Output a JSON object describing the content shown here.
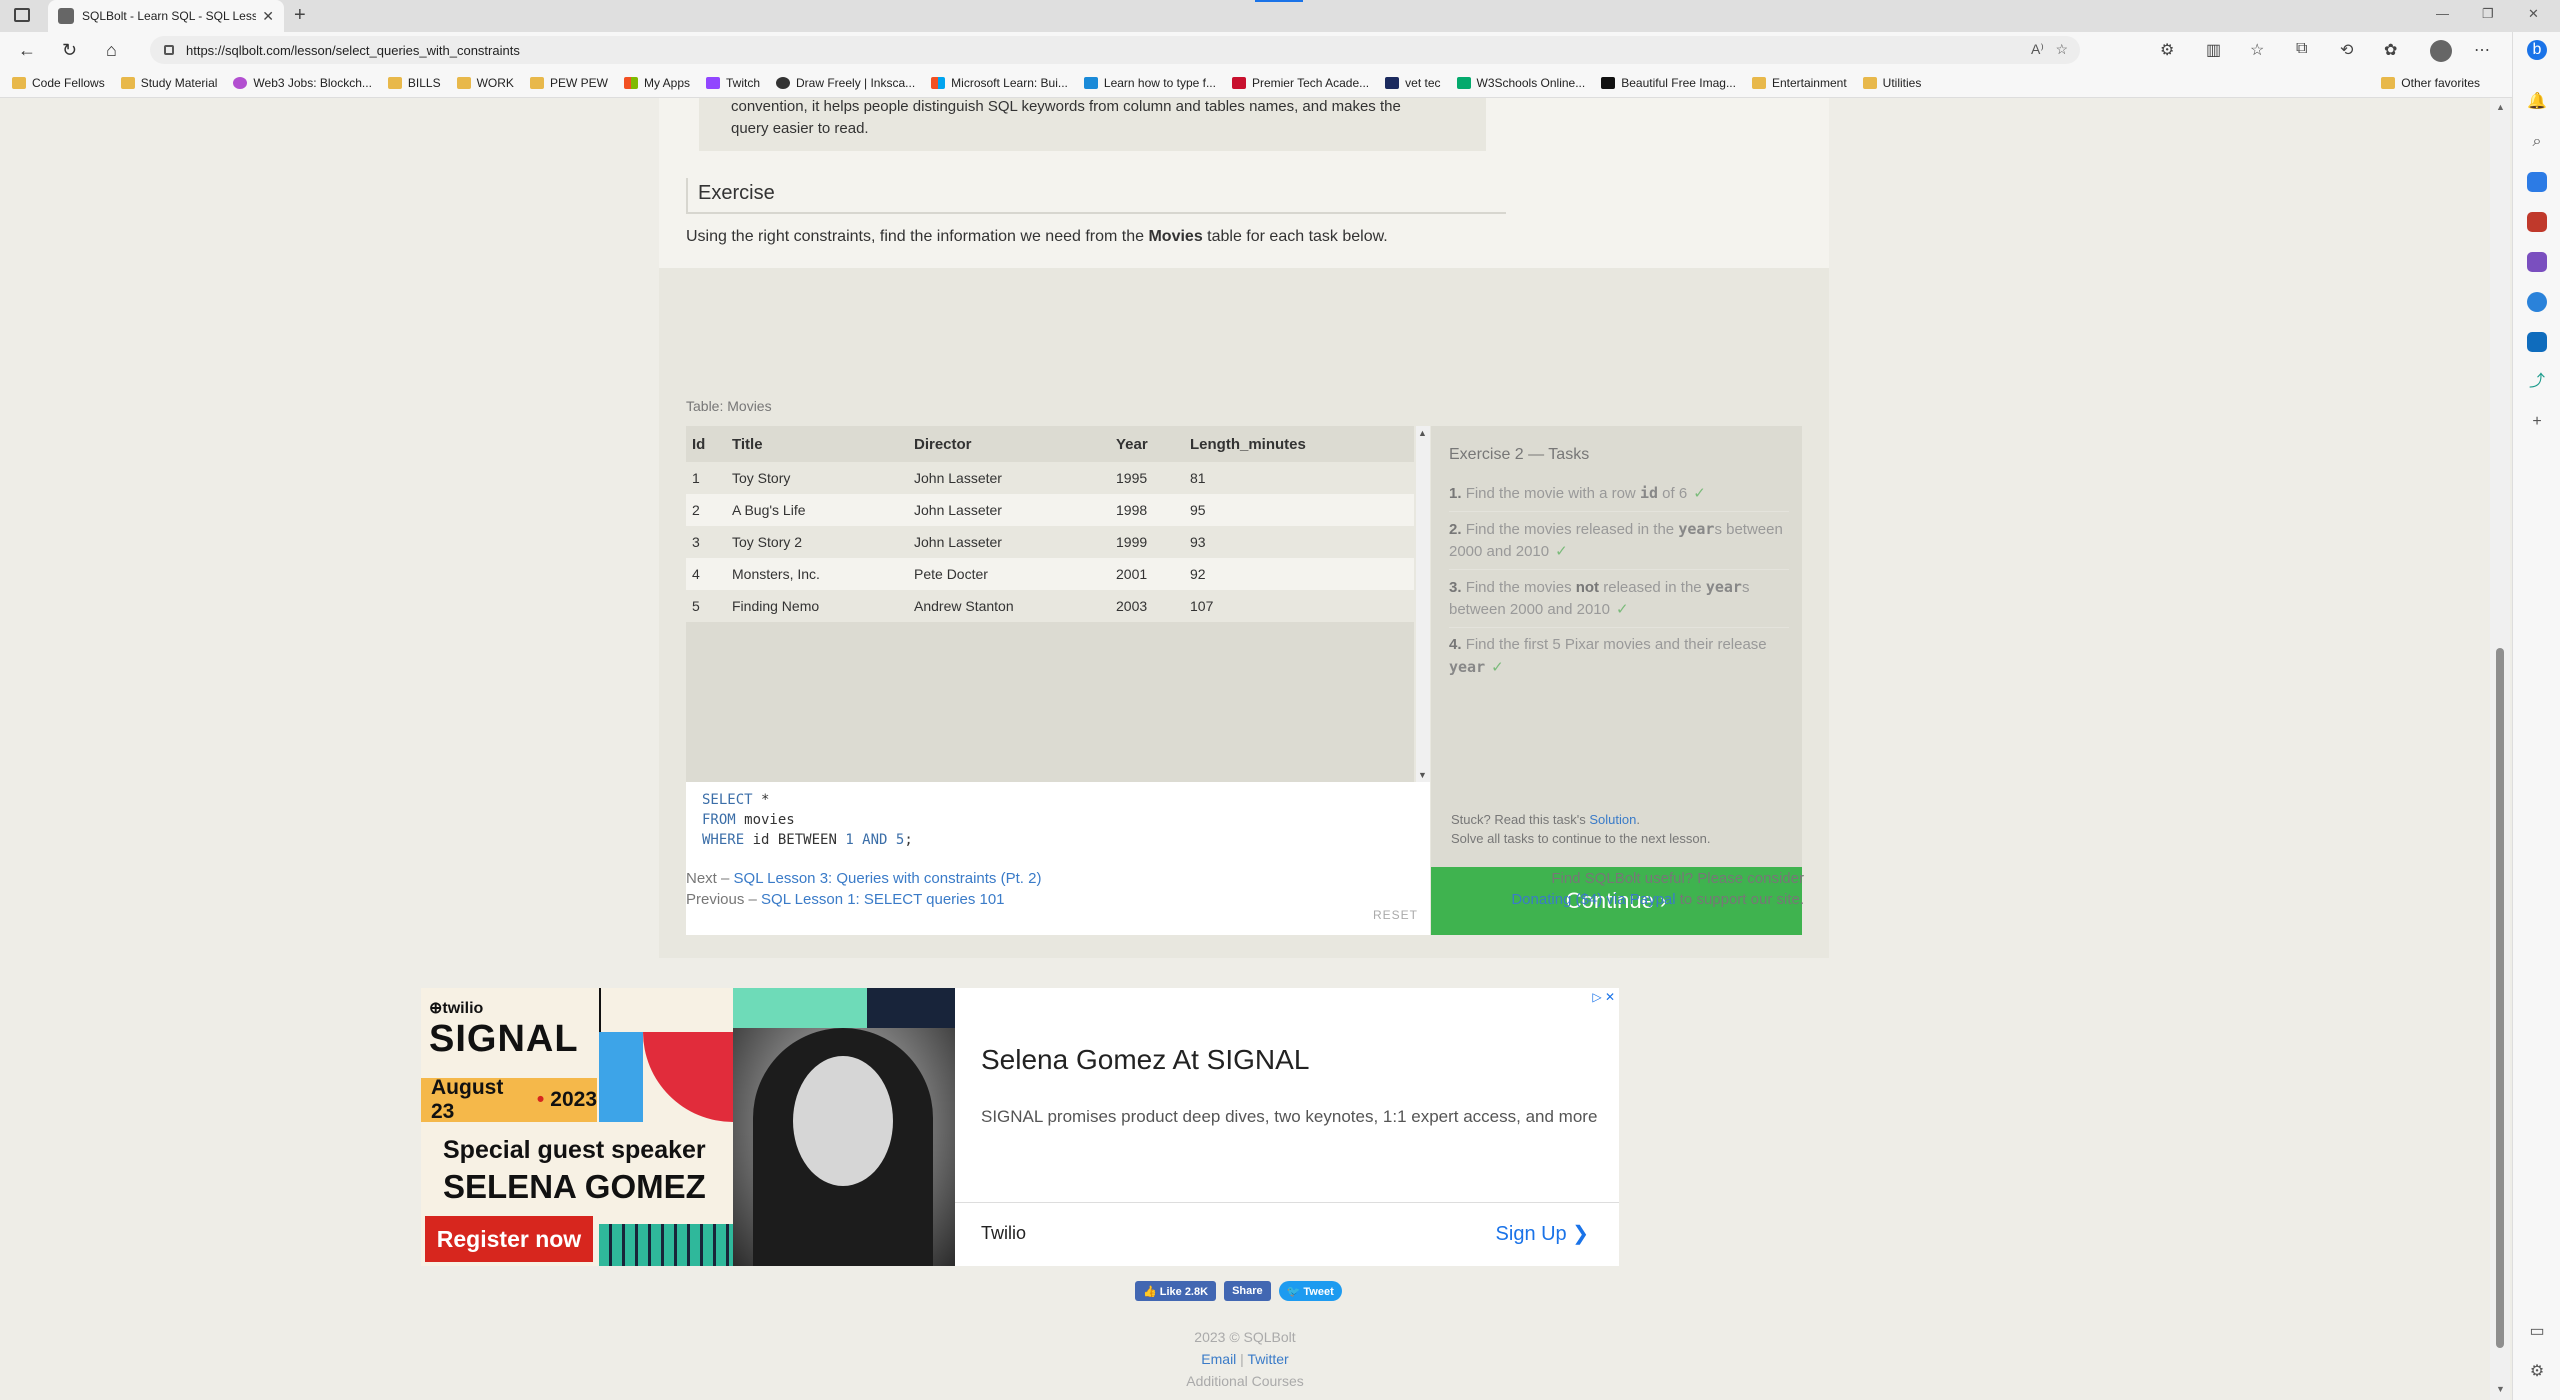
{
  "browser": {
    "tab_title": "SQLBolt - Learn SQL - SQL Lesso",
    "url": "https://sqlbolt.com/lesson/select_queries_with_constraints",
    "bookmarks": [
      "Code Fellows",
      "Study Material",
      "Web3 Jobs: Blockch...",
      "BILLS",
      "WORK",
      "PEW PEW",
      "My Apps",
      "Twitch",
      "Draw Freely | Inksca...",
      "Microsoft Learn: Bui...",
      "Learn how to type f...",
      "Premier Tech Acade...",
      "vet tec",
      "W3Schools Online...",
      "Beautiful Free Imag...",
      "Entertainment",
      "Utilities"
    ],
    "other_favorites": "Other favorites"
  },
  "lesson": {
    "note_line1": "convention, it helps people distinguish SQL keywords from column and tables names, and makes the",
    "note_line2": "query easier to read.",
    "exercise_heading": "Exercise",
    "exercise_intro_pre": "Using the right constraints, find the information we need from the ",
    "exercise_intro_bold": "Movies",
    "exercise_intro_post": " table for each task below."
  },
  "table": {
    "label": "Table: Movies",
    "columns": [
      "Id",
      "Title",
      "Director",
      "Year",
      "Length_minutes"
    ],
    "rows": [
      [
        "1",
        "Toy Story",
        "John Lasseter",
        "1995",
        "81"
      ],
      [
        "2",
        "A Bug's Life",
        "John Lasseter",
        "1998",
        "95"
      ],
      [
        "3",
        "Toy Story 2",
        "John Lasseter",
        "1999",
        "93"
      ],
      [
        "4",
        "Monsters, Inc.",
        "Pete Docter",
        "2001",
        "92"
      ],
      [
        "5",
        "Finding Nemo",
        "Andrew Stanton",
        "2003",
        "107"
      ]
    ]
  },
  "editor": {
    "line1_kw": "SELECT",
    "line1_rest": " *",
    "line2_kw": "FROM",
    "line2_rest": " movies",
    "line3_kw": "WHERE",
    "line3_mid": " id BETWEEN ",
    "line3_num1": "1",
    "line3_and": " AND ",
    "line3_num2": "5",
    "line3_end": ";",
    "reset": "RESET"
  },
  "tasks": {
    "heading": "Exercise 2 — Tasks",
    "t1_num": "1.",
    "t1_a": "Find the movie with a row ",
    "t1_code": "id",
    "t1_b": " of 6",
    "t2_num": "2.",
    "t2_a": "Find the movies released in the ",
    "t2_code": "year",
    "t2_b": "s between 2000 and 2010",
    "t3_num": "3.",
    "t3_a": "Find the movies ",
    "t3_bold": "not",
    "t3_b": " released in the ",
    "t3_code": "year",
    "t3_c": "s between 2000 and 2010",
    "t4_num": "4.",
    "t4_a": "Find the first 5 Pixar movies and their release ",
    "t4_code": "year",
    "check": "✓",
    "stuck_pre": "Stuck? Read this task's ",
    "stuck_link": "Solution",
    "stuck_post": ".",
    "solve_all": "Solve all tasks to continue to the next lesson.",
    "continue": "Continue ›"
  },
  "nav": {
    "next_pre": "Next – ",
    "next_link": "SQL Lesson 3: Queries with constraints (Pt. 2)",
    "prev_pre": "Previous – ",
    "prev_link": "SQL Lesson 1: SELECT queries 101",
    "donate_line1": "Find SQLBolt useful? Please consider",
    "donate_link": "Donating ($4) via Paypal",
    "donate_post": " to support our site."
  },
  "ad": {
    "logo": "⊕twilio",
    "signal": "SIGNAL",
    "date_a": "August 23",
    "date_dot": "•",
    "date_b": "2023",
    "special": "Special guest speaker",
    "speaker": "SELENA GOMEZ",
    "register": "Register now",
    "headline": "Selena Gomez At SIGNAL",
    "description": "SIGNAL promises product deep dives, two keynotes, 1:1 expert access, and more",
    "brand": "Twilio",
    "cta": "Sign Up ❯",
    "adchoices": "▷ ✕"
  },
  "social": {
    "like": "👍 Like 2.8K",
    "share": "Share",
    "tweet": "🐦 Tweet"
  },
  "footer": {
    "copyright": "2023 © SQLBolt",
    "email": "Email",
    "sep": " | ",
    "twitter": "Twitter",
    "more": "Additional Courses"
  }
}
